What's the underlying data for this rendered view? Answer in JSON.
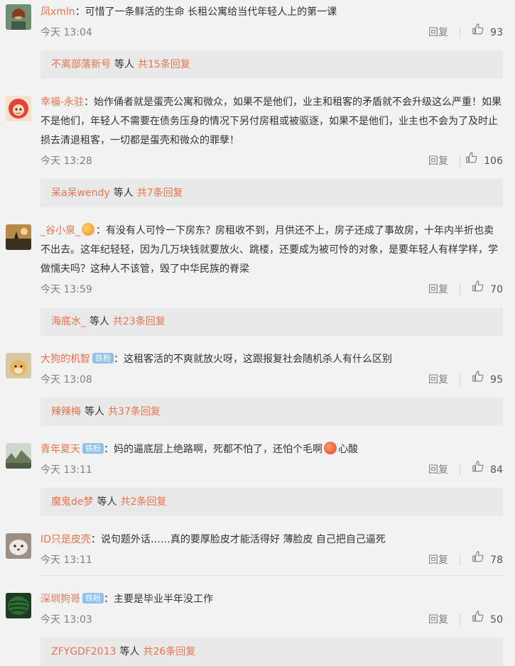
{
  "comments": [
    {
      "avatar_icon": "avatar-woman-icon",
      "username": "凤xmln",
      "badge": "",
      "text": "：可惜了一条鲜活的生命 长租公寓给当代年轻人上的第一课",
      "emoji": "",
      "text_after": "",
      "time": "今天 13:04",
      "reply_label": "回复",
      "likes": "93",
      "replies": {
        "name": "不离部落新号",
        "mid": "等人",
        "count": "共15条回复"
      }
    },
    {
      "avatar_icon": "avatar-cartoon-icon",
      "username": "幸福-永驻",
      "badge": "",
      "text": "：始作俑者就是蛋壳公寓和微众，如果不是他们，业主和租客的矛盾就不会升级这么严重！如果不是他们，年轻人不需要在债务压身的情况下另付房租或被驱逐，如果不是他们，业主也不会为了及时止损去清退租客，一切都是蛋壳和微众的罪孽！",
      "emoji": "",
      "text_after": "",
      "time": "今天 13:28",
      "reply_label": "回复",
      "likes": "106",
      "replies": {
        "name": "呆a呆wendy",
        "mid": "等人",
        "count": "共7条回复"
      }
    },
    {
      "avatar_icon": "avatar-sunset-icon",
      "username": "_谷小泉_",
      "badge": "",
      "text": "：有没有人可怜一下房东？房租收不到，月供还不上，房子还成了事故房，十年内半折也卖不出去。这年纪轻轻，因为几万块钱就要放火、跳楼，还要成为被可怜的对象，是要年轻人有样学样，学做懦夫吗？这种人不该管，毁了中华民族的脊梁",
      "emoji": "heart-emoji-icon",
      "text_after": "",
      "time": "今天 13:59",
      "reply_label": "回复",
      "likes": "70",
      "replies": {
        "name": "海底水_",
        "mid": "等人",
        "count": "共23条回复"
      }
    },
    {
      "avatar_icon": "avatar-dog-icon",
      "username": "大狗的机智",
      "badge": "铁粉",
      "text": "：这租客活的不爽就放火呀，这跟报复社会随机杀人有什么区别",
      "emoji": "",
      "text_after": "",
      "time": "今天 13:08",
      "reply_label": "回复",
      "likes": "95",
      "replies": {
        "name": "辣辣梅",
        "mid": "等人",
        "count": "共37条回复"
      }
    },
    {
      "avatar_icon": "avatar-landscape-icon",
      "username": "青年夏天",
      "badge": "铁粉",
      "text": "：妈的逼底层上绝路啊，死都不怕了，还怕个毛啊",
      "emoji": "sad-emoji-icon",
      "text_after": "心酸",
      "time": "今天 13:11",
      "reply_label": "回复",
      "likes": "84",
      "replies": {
        "name": "魔鬼de梦",
        "mid": "等人",
        "count": "共2条回复"
      }
    },
    {
      "avatar_icon": "avatar-pet-icon",
      "username": "ID只是皮壳",
      "badge": "",
      "text": "：说句题外话……真的要厚脸皮才能活得好 薄脸皮 自己把自己逼死",
      "emoji": "",
      "text_after": "",
      "time": "今天 13:11",
      "reply_label": "回复",
      "likes": "78",
      "replies": null
    },
    {
      "avatar_icon": "avatar-melon-icon",
      "username": "深圳狗哥",
      "badge": "铁粉",
      "text": "：主要是毕业半年没工作",
      "emoji": "",
      "text_after": "",
      "time": "今天 13:03",
      "reply_label": "回复",
      "likes": "50",
      "replies": {
        "name": "ZFYGDF2013",
        "mid": "等人",
        "count": "共26条回复"
      }
    }
  ]
}
